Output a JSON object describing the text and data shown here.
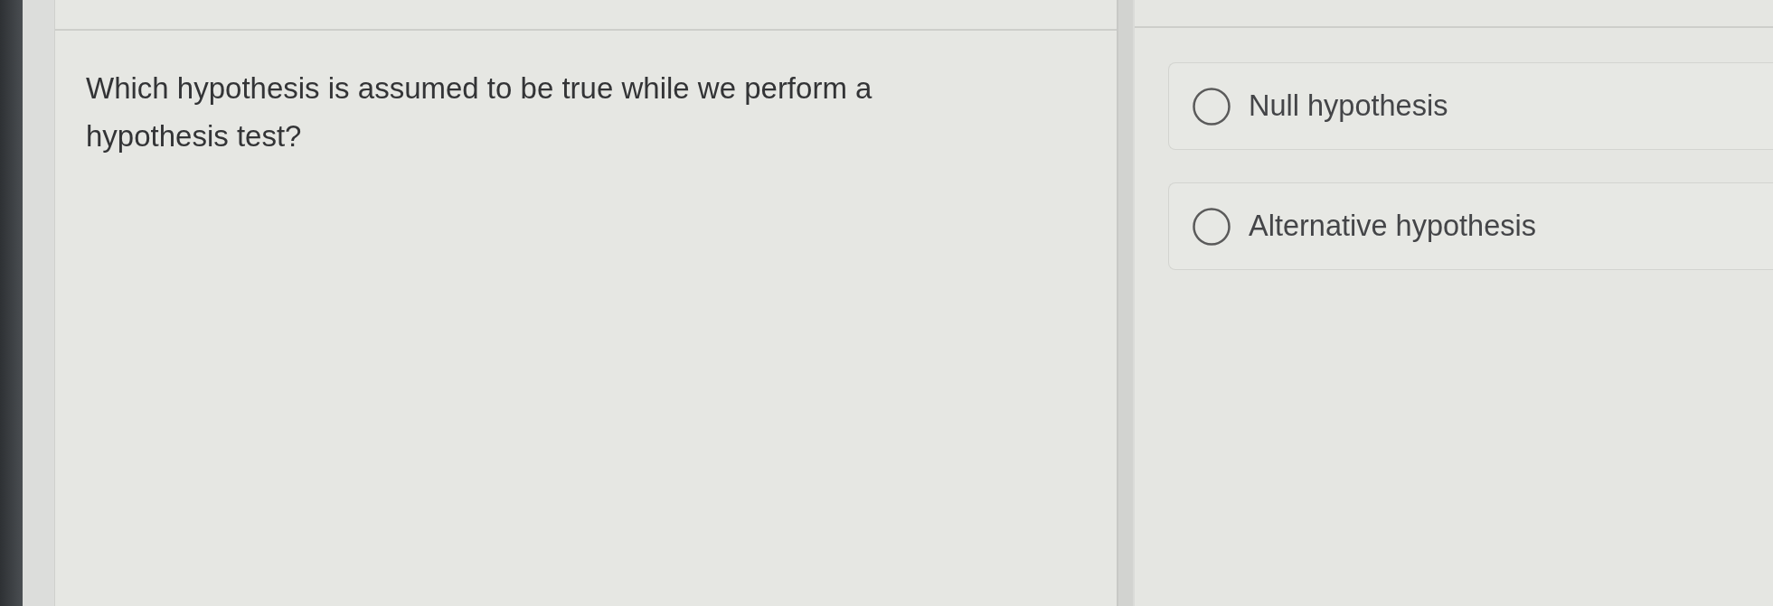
{
  "question": "Which hypothesis is assumed to be true while we perform a hypothesis test?",
  "options": [
    {
      "label": "Null hypothesis",
      "selected": false
    },
    {
      "label": "Alternative hypothesis",
      "selected": false
    }
  ]
}
